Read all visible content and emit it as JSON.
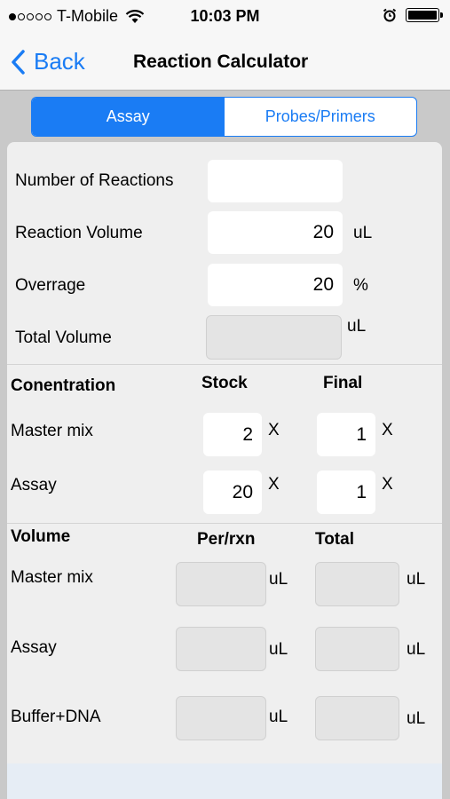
{
  "status": {
    "carrier": "T-Mobile",
    "time": "10:03 PM"
  },
  "nav": {
    "back_label": "Back",
    "title": "Reaction Calculator"
  },
  "tabs": [
    {
      "label": "Assay",
      "active": true
    },
    {
      "label": "Probes/Primers",
      "active": false
    }
  ],
  "setup": {
    "reactions_label": "Number of Reactions",
    "reactions_value": "",
    "volume_label": "Reaction Volume",
    "volume_value": "20",
    "volume_unit": "uL",
    "overage_label": "Overrage",
    "overage_value": "20",
    "overage_unit": "%",
    "total_label": "Total Volume",
    "total_unit": "uL"
  },
  "concentration": {
    "heading": "Conentration",
    "stock_header": "Stock",
    "final_header": "Final",
    "rows": [
      {
        "label": "Master mix",
        "stock": "2",
        "final": "1",
        "unit": "X"
      },
      {
        "label": "Assay",
        "stock": "20",
        "final": "1",
        "unit": "X"
      }
    ]
  },
  "volume": {
    "heading": "Volume",
    "per_header": "Per/rxn",
    "total_header": "Total",
    "rows": [
      {
        "label": "Master mix",
        "unit": "uL"
      },
      {
        "label": "Assay",
        "unit": "uL"
      },
      {
        "label": "Buffer+DNA",
        "unit": "uL"
      }
    ]
  },
  "colors": {
    "accent": "#1a7cf4",
    "panel": "#efefef",
    "background": "#c9c9c9"
  }
}
